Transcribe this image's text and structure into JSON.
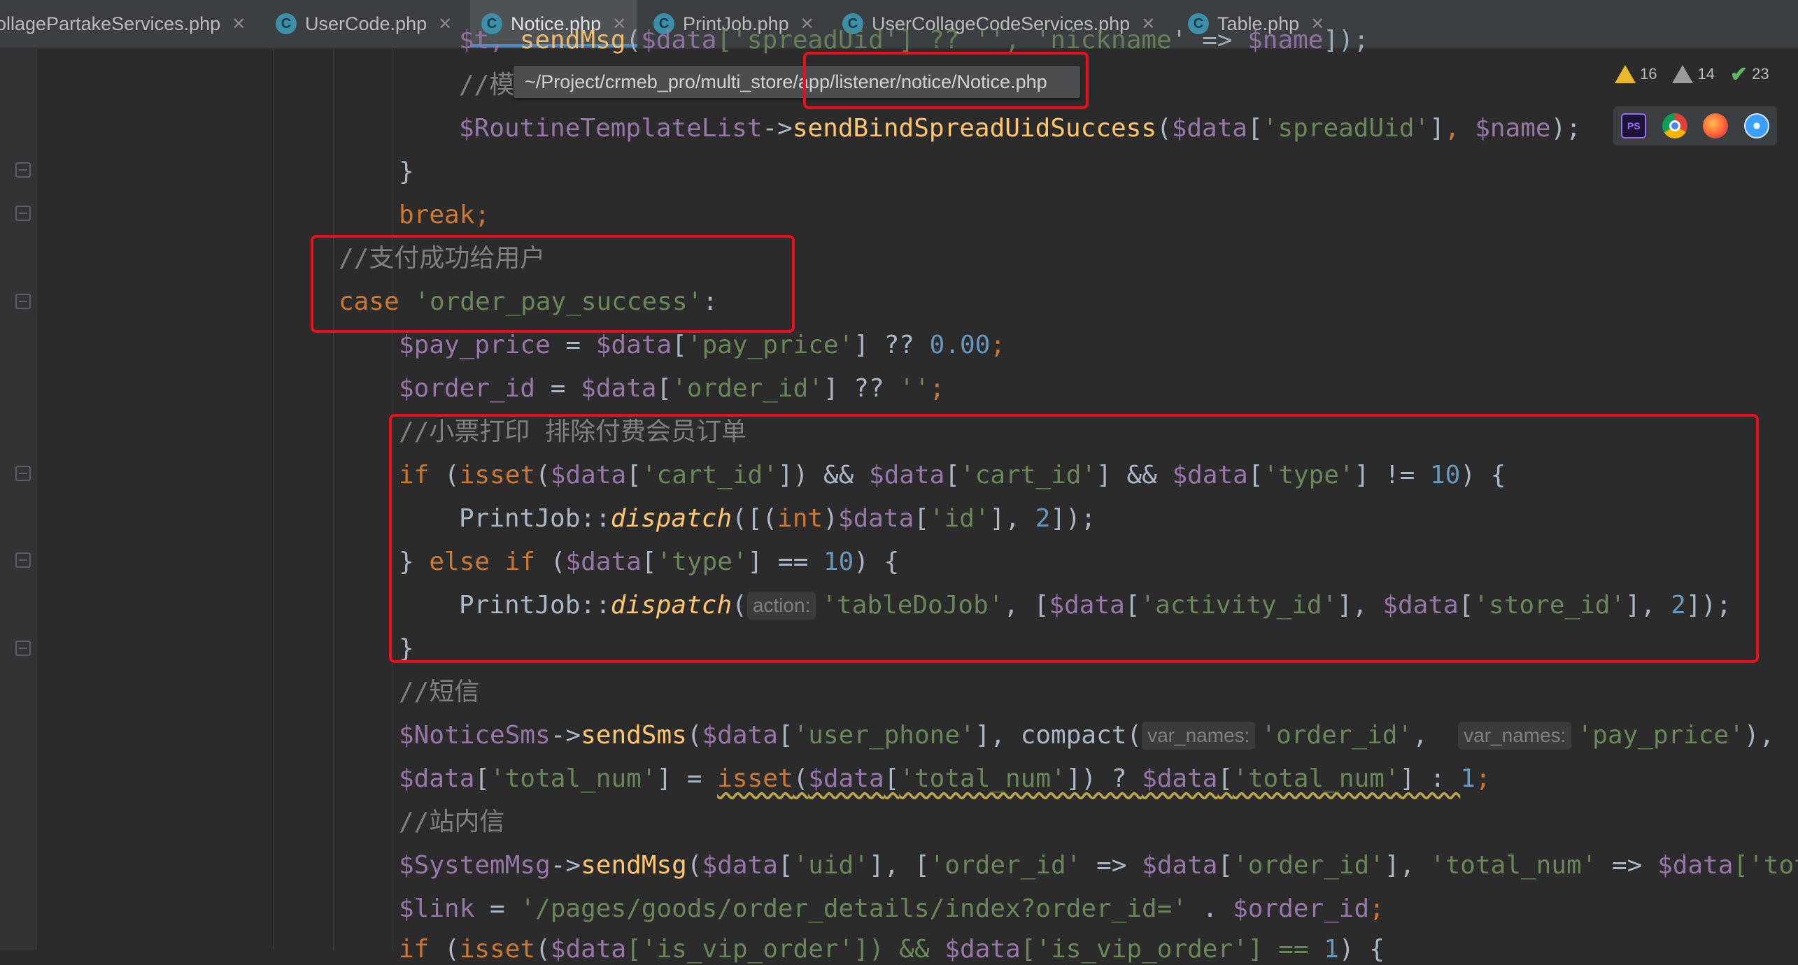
{
  "tabs": [
    {
      "label": "ollagePartakeServices.php",
      "icon": false,
      "active": false
    },
    {
      "label": "UserCode.php",
      "icon": true,
      "active": false
    },
    {
      "label": "Notice.php",
      "icon": true,
      "active": true
    },
    {
      "label": "PrintJob.php",
      "icon": true,
      "active": false
    },
    {
      "label": "UserCollageCodeServices.php",
      "icon": true,
      "active": false
    },
    {
      "label": "Table.php",
      "icon": true,
      "active": false
    }
  ],
  "tab_icon_letter": "C",
  "tab_close_glyph": "✕",
  "tooltip": {
    "path": "~/Project/crmeb_pro/multi_store/app/listener/notice/Notice.php"
  },
  "inspections": {
    "warnings": "16",
    "weak_warnings": "14",
    "typos": "23"
  },
  "browsers": [
    "phpstorm-icon",
    "chrome-icon",
    "firefox-icon",
    "safari-icon"
  ],
  "colors": {
    "keyword": "#cc7832",
    "variable": "#9876aa",
    "string": "#6a8759",
    "number": "#6897bb",
    "function": "#ffc66d",
    "comment": "#808080",
    "plain": "#a9b7c6",
    "highlight_box": "#e8101c",
    "background": "#2b2b2b"
  },
  "code": {
    "l0": {
      "p1": "$t, ",
      "p2": "sendMsg",
      "p3": "(",
      "p4": "$data",
      "p5": "['",
      "p6": "spreadUid",
      "p7": "'] ?? '', '",
      "p8": "nickname",
      "p9": "' => ",
      "p10": "$name",
      "p11": "]);"
    },
    "l1": {
      "c": "//模"
    },
    "l2": {
      "v1": "$RoutineTemplateList",
      "a": "->",
      "f": "sendBindSpreadUidSuccess",
      "o": "(",
      "v2": "$data",
      "b1": "[",
      "s": "'spreadUid'",
      "b2": "]",
      "cm": ", ",
      "v3": "$name",
      "e": ");"
    },
    "l3": {
      "t": "}"
    },
    "l4": {
      "k": "break",
      "e": ";"
    },
    "l5": {
      "c": "//支付成功给用户"
    },
    "l6": {
      "k": "case ",
      "s": "'order_pay_success'",
      "e": ":"
    },
    "l7": {
      "v1": "$pay_price",
      "eq": " = ",
      "v2": "$data",
      "b1": "[",
      "s": "'pay_price'",
      "b2": "] ?? ",
      "n": "0.00",
      "e": ";"
    },
    "l8": {
      "v1": "$order_id",
      "eq": " = ",
      "v2": "$data",
      "b1": "[",
      "s": "'order_id'",
      "b2": "] ?? ",
      "s2": "''",
      "e": ";"
    },
    "l9": {
      "c": "//小票打印 排除付费会员订单"
    },
    "l10": {
      "k": "if ",
      "p": "(",
      "f": "isset",
      "p2": "(",
      "v1": "$data",
      "b1": "[",
      "s1": "'cart_id'",
      "b2": "]) && ",
      "v2": "$data",
      "b3": "[",
      "s2": "'cart_id'",
      "b4": "] && ",
      "v3": "$data",
      "b5": "[",
      "s3": "'type'",
      "b6": "] != ",
      "n": "10",
      "e": ") {"
    },
    "l11": {
      "cls": "PrintJob",
      "dc": "::",
      "f": "dispatch",
      "p": "([(",
      "k": "int",
      "p2": ")",
      "v": "$data",
      "b1": "[",
      "s": "'id'",
      "b2": "], ",
      "n": "2",
      "e": "]);"
    },
    "l12": {
      "b": "} ",
      "k": "else if ",
      "p": "(",
      "v": "$data",
      "b1": "[",
      "s": "'type'",
      "b2": "] == ",
      "n": "10",
      "e": ") {"
    },
    "l13": {
      "cls": "PrintJob",
      "dc": "::",
      "f": "dispatch",
      "p": "(",
      "hint": "action:",
      "s1": "'tableDoJob'",
      "c1": ", [",
      "v1": "$data",
      "b1": "[",
      "s2": "'activity_id'",
      "b2": "], ",
      "v2": "$data",
      "b3": "[",
      "s3": "'store_id'",
      "b4": "], ",
      "n": "2",
      "e": "]);"
    },
    "l14": {
      "t": "}"
    },
    "l15": {
      "c": "//短信"
    },
    "l16": {
      "v1": "$NoticeSms",
      "a": "->",
      "f": "sendSms",
      "p": "(",
      "v2": "$data",
      "b1": "[",
      "s1": "'user_phone'",
      "b2": "], ",
      "f2": "compact(",
      "hint1": "var_names:",
      "s2": "'order_id'",
      "c": ",  ",
      "hint2": "var_names:",
      "s3": "'pay_price'",
      "e": "),"
    },
    "l17": {
      "v1": "$data",
      "b1": "[",
      "s1": "'total_num'",
      "b2": "] = ",
      "f": "isset",
      "p": "(",
      "v2": "$data",
      "b3": "[",
      "s2": "'total_num'",
      "b4": "]) ? ",
      "v3": "$data",
      "b5": "[",
      "s3": "'total_num'",
      "b6": "] : ",
      "n": "1",
      "e": ";"
    },
    "l18": {
      "c": "//站内信"
    },
    "l19": {
      "v1": "$SystemMsg",
      "a": "->",
      "f": "sendMsg",
      "p": "(",
      "v2": "$data",
      "b1": "[",
      "s1": "'uid'",
      "b2": "], [",
      "s2": "'order_id'",
      "ar": " => ",
      "v3": "$data",
      "b3": "[",
      "s3": "'order_id'",
      "b4": "], ",
      "s4": "'total_num'",
      "ar2": " => ",
      "v4": "$data",
      "b5": "['",
      "s5": "tot"
    },
    "l20": {
      "v": "$link",
      "eq": " = ",
      "s": "'/pages/goods/order_details/index?order_id='",
      "dot": " . ",
      "v2": "$order_id",
      "e": ";"
    },
    "l21": {
      "k": "if ",
      "p": "(",
      "f": "isset",
      "p2": "(",
      "v1": "$data",
      "b1": "['",
      "s1": "is_vip_order",
      "b2": "']) && ",
      "v2": "$data",
      "b3": "['",
      "s2": "is_vip_order",
      "b4": "'] == ",
      "n": "1",
      "e": ") {"
    }
  }
}
